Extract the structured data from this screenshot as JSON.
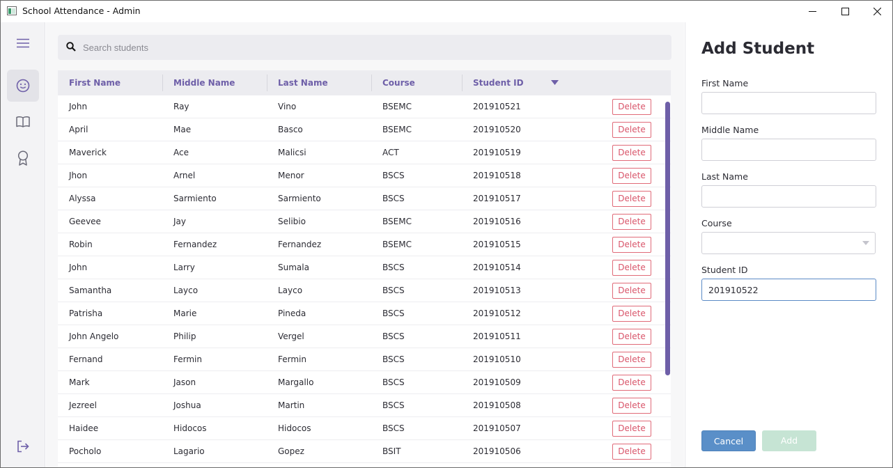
{
  "window": {
    "title": "School Attendance - Admin"
  },
  "search": {
    "placeholder": "Search students",
    "value": ""
  },
  "table": {
    "columns": [
      "First Name",
      "Middle Name",
      "Last Name",
      "Course",
      "Student ID"
    ],
    "delete_label": "Delete",
    "rows": [
      [
        "John",
        "Ray",
        "Vino",
        "BSEMC",
        "201910521"
      ],
      [
        "April",
        "Mae",
        "Basco",
        "BSEMC",
        "201910520"
      ],
      [
        "Maverick",
        "Ace",
        "Malicsi",
        "ACT",
        "201910519"
      ],
      [
        "Jhon",
        "Arnel",
        "Menor",
        "BSCS",
        "201910518"
      ],
      [
        "Alyssa",
        "Sarmiento",
        "Sarmiento",
        "BSCS",
        "201910517"
      ],
      [
        "Geevee",
        "Jay",
        "Selibio",
        "BSEMC",
        "201910516"
      ],
      [
        "Robin",
        "Fernandez",
        "Fernandez",
        "BSEMC",
        "201910515"
      ],
      [
        "John",
        "Larry",
        "Sumala",
        "BSCS",
        "201910514"
      ],
      [
        "Samantha",
        "Layco",
        "Layco",
        "BSCS",
        "201910513"
      ],
      [
        "Patrisha",
        "Marie",
        "Pineda",
        "BSCS",
        "201910512"
      ],
      [
        "John Angelo",
        "Philip",
        "Vergel",
        "BSCS",
        "201910511"
      ],
      [
        "Fernand",
        "Fermin",
        "Fermin",
        "BSCS",
        "201910510"
      ],
      [
        "Mark",
        "Jason",
        "Margallo",
        "BSCS",
        "201910509"
      ],
      [
        "Jezreel",
        "Joshua",
        "Martin",
        "BSCS",
        "201910508"
      ],
      [
        "Haidee",
        "Hidocos",
        "Hidocos",
        "BSCS",
        "201910507"
      ],
      [
        "Pocholo",
        "Lagario",
        "Gopez",
        "BSIT",
        "201910506"
      ]
    ]
  },
  "panel": {
    "title": "Add Student",
    "first_name_label": "First Name",
    "first_name_value": "",
    "middle_name_label": "Middle Name",
    "middle_name_value": "",
    "last_name_label": "Last Name",
    "last_name_value": "",
    "course_label": "Course",
    "course_value": "",
    "student_id_label": "Student ID",
    "student_id_value": "201910522",
    "cancel_label": "Cancel",
    "add_label": "Add"
  },
  "colors": {
    "accent": "#6e5fa8",
    "danger": "#d9556a",
    "primary_button": "#5a8fc8",
    "disabled_button": "#c6e4d4"
  },
  "icons": {
    "menu": "hamburger-menu-icon",
    "students": "smiley-face-icon",
    "subjects": "open-book-icon",
    "awards": "award-ribbon-icon",
    "logout": "logout-icon",
    "search": "search-icon",
    "sort": "sort-descending-icon"
  }
}
